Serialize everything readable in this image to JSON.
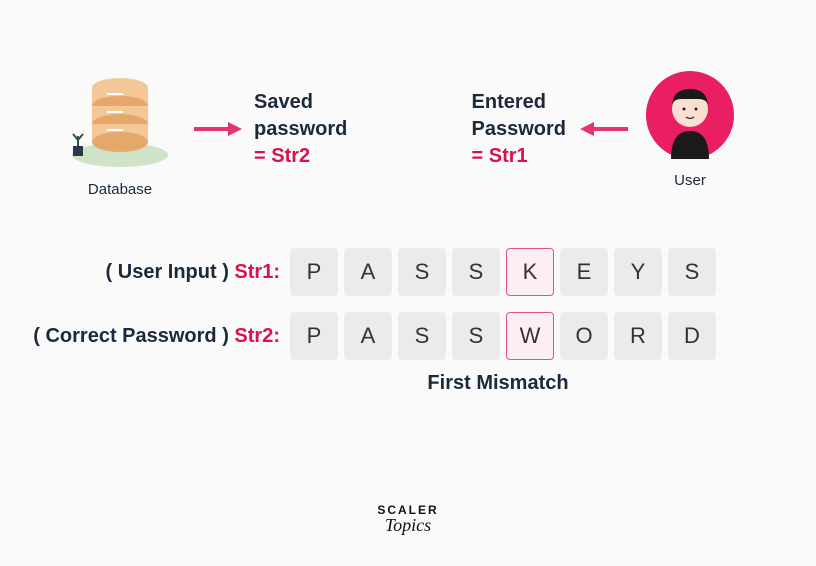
{
  "top": {
    "database_label": "Database",
    "saved_line1": "Saved",
    "saved_line2": "password",
    "saved_eq": "= Str2",
    "entered_line1": "Entered",
    "entered_line2": "Password",
    "entered_eq": "= Str1",
    "user_label": "User"
  },
  "rows": {
    "row1_label_prefix": "( User Input ) ",
    "row1_var": "Str1:",
    "row1_cells": [
      "P",
      "A",
      "S",
      "S",
      "K",
      "E",
      "Y",
      "S"
    ],
    "row2_label_prefix": "( Correct Password ) ",
    "row2_var": "Str2:",
    "row2_cells": [
      "P",
      "A",
      "S",
      "S",
      "W",
      "O",
      "R",
      "D"
    ],
    "mismatch_index": 4,
    "mismatch_label": "First Mismatch"
  },
  "logo": {
    "line1": "SCALER",
    "line2": "Topics"
  },
  "colors": {
    "accent": "#d6134c",
    "cell_bg": "#ebebeb",
    "mismatch_bg": "#fdeef2",
    "mismatch_border": "#e5527a"
  }
}
